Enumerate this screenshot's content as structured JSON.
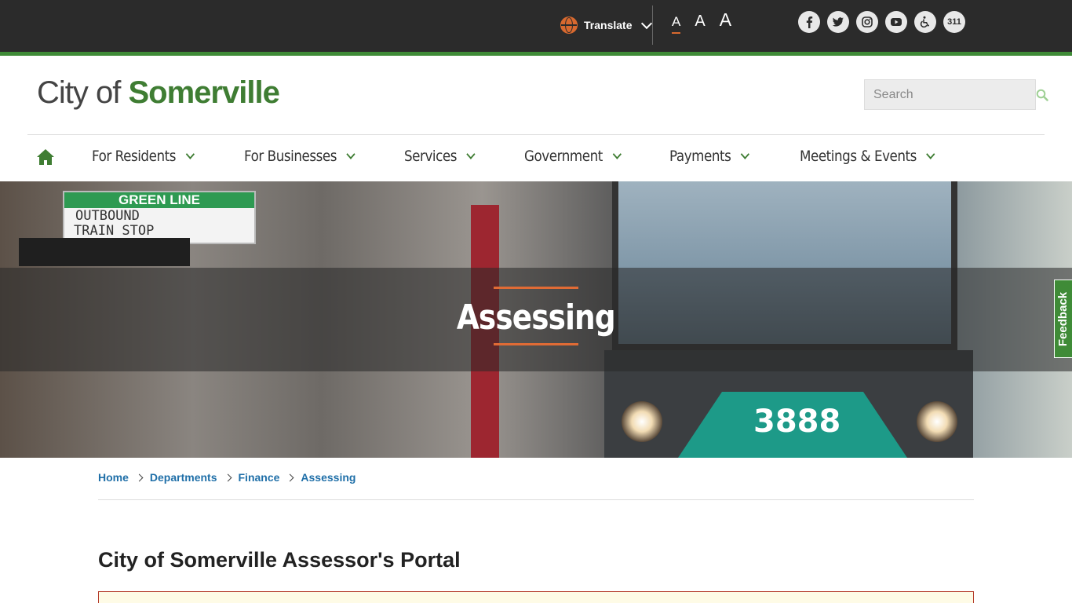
{
  "topbar": {
    "translate_label": "Translate",
    "font_sizes": [
      "A",
      "A",
      "A"
    ],
    "social": [
      {
        "icon": "facebook-icon"
      },
      {
        "icon": "twitter-icon"
      },
      {
        "icon": "instagram-icon"
      },
      {
        "icon": "youtube-icon"
      },
      {
        "icon": "accessibility-icon"
      },
      {
        "icon": "311-icon",
        "label": "311"
      }
    ],
    "accent": "#d8692f",
    "background": "#2b2b2b",
    "brand_green": "#3f8b37"
  },
  "header": {
    "logo_prefix": "City of",
    "logo_name": "Somerville",
    "search_placeholder": "Search"
  },
  "nav": {
    "items": [
      {
        "label": "For Residents"
      },
      {
        "label": "For Businesses"
      },
      {
        "label": "Services"
      },
      {
        "label": "Government"
      },
      {
        "label": "Payments"
      },
      {
        "label": "Meetings & Events"
      }
    ]
  },
  "hero": {
    "title": "Assessing",
    "sign_line": "GREEN LINE",
    "sign_outbound": "OUTBOUND",
    "sign_stop": "TRAIN STOP",
    "train_number": "3888"
  },
  "feedback_label": "Feedback",
  "breadcrumb": [
    "Home",
    "Departments",
    "Finance",
    "Assessing"
  ],
  "main": {
    "title": "City of Somerville Assessor's Portal"
  }
}
